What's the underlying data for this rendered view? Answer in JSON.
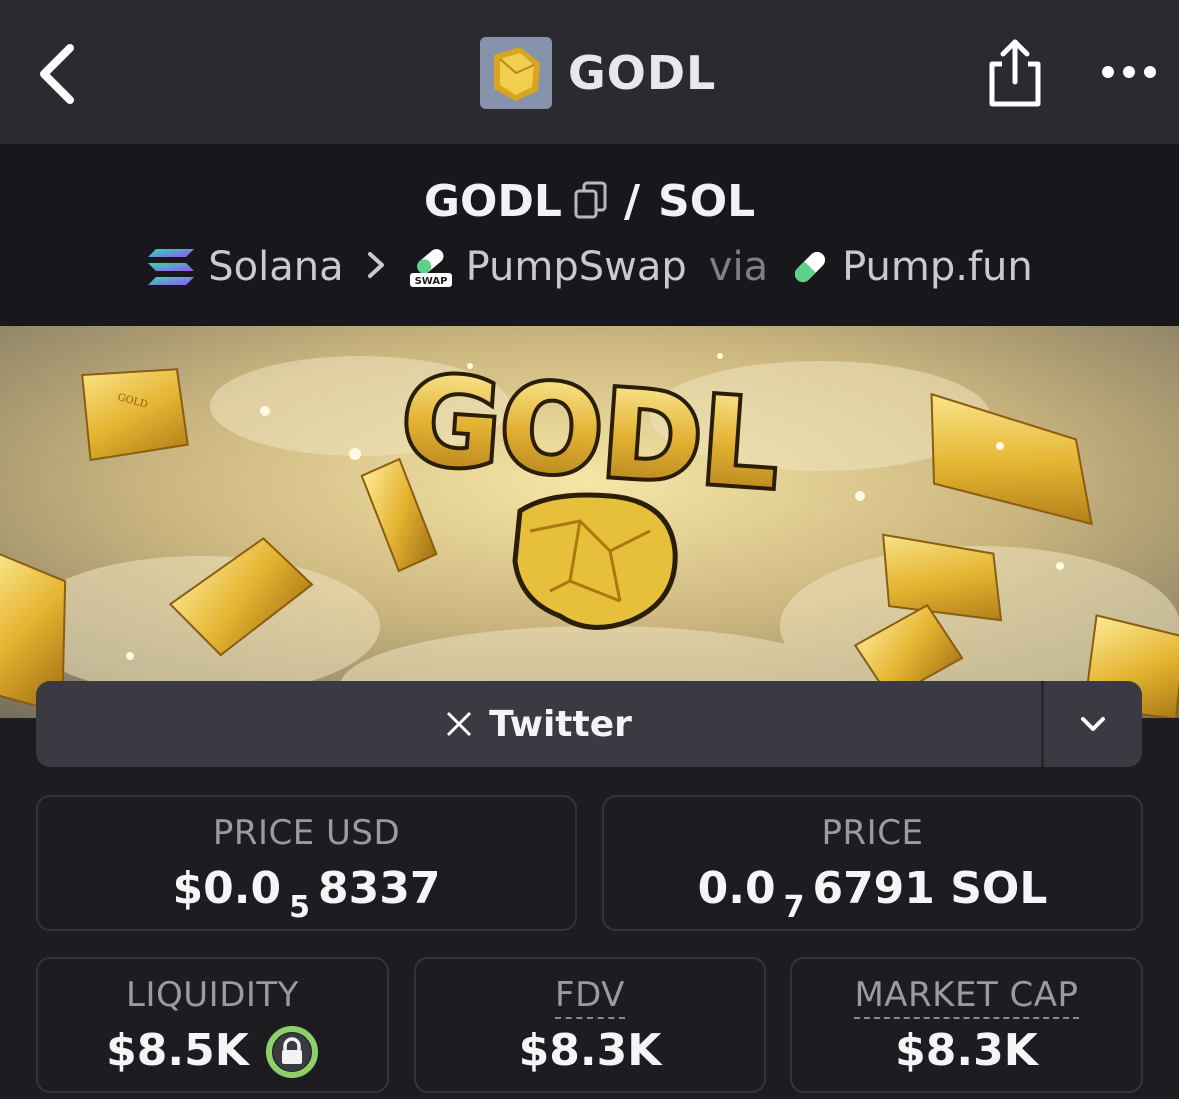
{
  "topbar": {
    "title": "GODL"
  },
  "pair": {
    "base": "GODL",
    "separator": "/",
    "quote": "SOL"
  },
  "chain": {
    "network": "Solana",
    "dex": "PumpSwap",
    "dex_badge": "SWAP",
    "via": "via",
    "launchpad": "Pump.fun"
  },
  "banner": {
    "logo_text": "GODL",
    "bar_text": "GOLD"
  },
  "socials": {
    "twitter_label": "Twitter"
  },
  "stats": {
    "price_usd": {
      "label": "PRICE USD",
      "prefix": "$0.0",
      "zeros": "5",
      "digits": "8337"
    },
    "price": {
      "label": "PRICE",
      "prefix": "0.0",
      "zeros": "7",
      "digits": "6791 SOL"
    },
    "liquidity": {
      "label": "LIQUIDITY",
      "value": "$8.5K"
    },
    "fdv": {
      "label": "FDV",
      "value": "$8.3K"
    },
    "market_cap": {
      "label": "MARKET CAP",
      "value": "$8.3K"
    }
  },
  "colors": {
    "background": "#1c1c21",
    "topbar": "#2a2a30",
    "gold": "#e0b63c",
    "lock_green": "#8fcf6a"
  }
}
